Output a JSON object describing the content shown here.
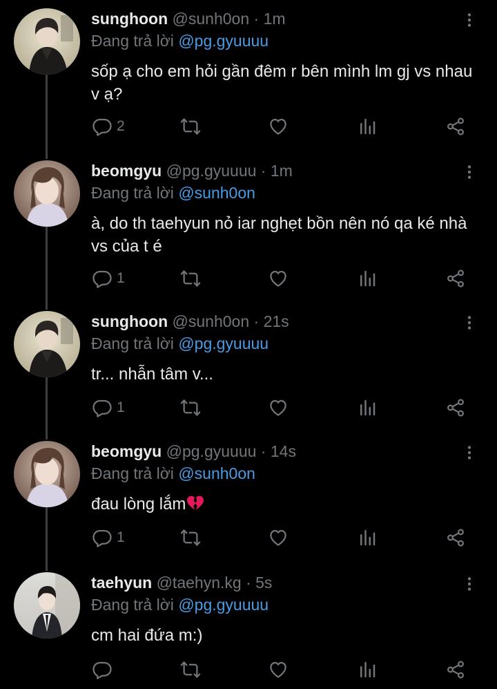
{
  "reply_prefix": "Đang trả lời",
  "tweets": [
    {
      "name": "sunghoon",
      "handle": "@sunh0on",
      "time": "1m",
      "reply_to": "@pg.gyuuuu",
      "text": "sốp ạ cho em hỏi gần đêm r bên mình lm gj vs nhau v ạ?",
      "replies": "2",
      "avatar": "avatar-sunghoon"
    },
    {
      "name": "beomgyu",
      "handle": "@pg.gyuuuu",
      "time": "1m",
      "reply_to": "@sunh0on",
      "text": "à, do th taehyun nỏ iar nghẹt bồn nên nó qa ké nhà vs của t é",
      "replies": "1",
      "avatar": "avatar-beomgyu"
    },
    {
      "name": "sunghoon",
      "handle": "@sunh0on",
      "time": "21s",
      "reply_to": "@pg.gyuuuu",
      "text": "tr... nhẫn tâm v...",
      "replies": "1",
      "avatar": "avatar-sunghoon"
    },
    {
      "name": "beomgyu",
      "handle": "@pg.gyuuuu",
      "time": "14s",
      "reply_to": "@sunh0on",
      "text": "đau lòng lắm",
      "emoji": "broken-heart-icon",
      "replies": "1",
      "avatar": "avatar-beomgyu"
    },
    {
      "name": "taehyun",
      "handle": "@taehyn.kg",
      "time": "5s",
      "reply_to": "@pg.gyuuuu",
      "text": "cm hai đứa m:)",
      "replies": "",
      "avatar": "avatar-taehyun"
    }
  ],
  "colors": {
    "background": "#000000",
    "mention": "#4a9be3",
    "secondary": "#71767b",
    "broken_heart": "#e2195b"
  }
}
